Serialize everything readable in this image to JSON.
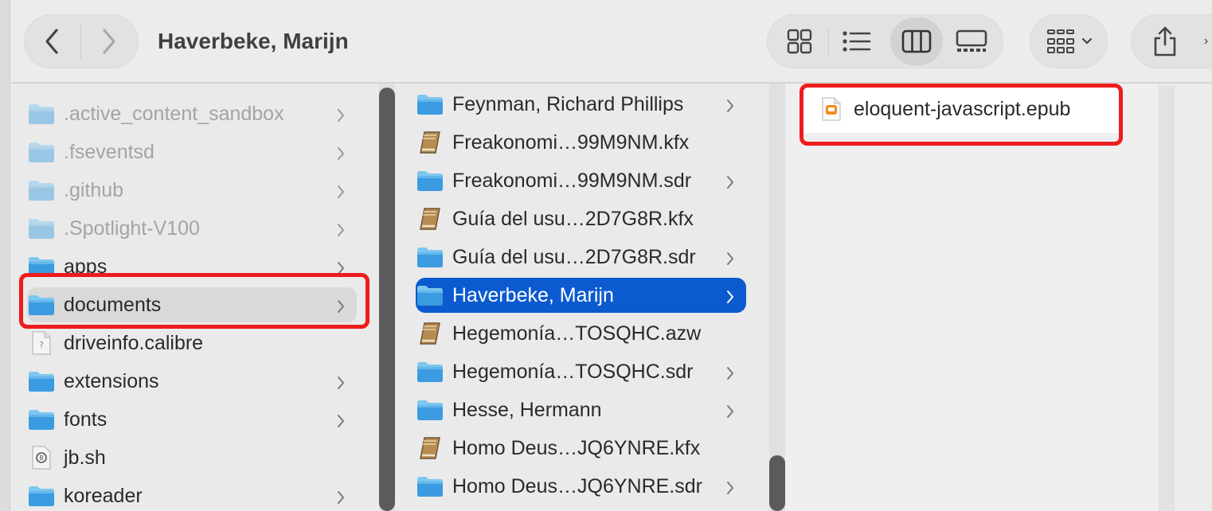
{
  "window": {
    "title": "Haverbeke, Marijn"
  },
  "toolbar": {
    "nav": {
      "back_icon": "chevron-left-icon",
      "forward_icon": "chevron-right-icon"
    },
    "view_modes": [
      {
        "name": "icon-view",
        "icon": "grid-icon"
      },
      {
        "name": "list-view",
        "icon": "list-icon"
      },
      {
        "name": "column-view",
        "icon": "columns-icon",
        "active": true
      },
      {
        "name": "gallery-view",
        "icon": "gallery-icon"
      }
    ],
    "group_icon": "group-by-icon",
    "share_icon": "share-icon"
  },
  "columns": [
    {
      "name": "root",
      "items": [
        {
          "label": ".active_content_sandbox",
          "kind": "folder",
          "hidden": true,
          "children": true
        },
        {
          "label": ".fseventsd",
          "kind": "folder",
          "hidden": true,
          "children": true
        },
        {
          "label": ".github",
          "kind": "folder",
          "hidden": true,
          "children": true
        },
        {
          "label": ".Spotlight-V100",
          "kind": "folder",
          "hidden": true,
          "children": true
        },
        {
          "label": "apps",
          "kind": "folder",
          "children": true
        },
        {
          "label": "documents",
          "kind": "folder",
          "children": true,
          "selected": true,
          "highlighted": true
        },
        {
          "label": "driveinfo.calibre",
          "kind": "unknown-file"
        },
        {
          "label": "extensions",
          "kind": "folder",
          "children": true
        },
        {
          "label": "fonts",
          "kind": "folder",
          "children": true
        },
        {
          "label": "jb.sh",
          "kind": "script-file"
        },
        {
          "label": "koreader",
          "kind": "folder",
          "children": true
        }
      ]
    },
    {
      "name": "documents",
      "items": [
        {
          "label": "Feynman, Richard Phillips",
          "kind": "folder",
          "children": true
        },
        {
          "label": "Freakonomi…99M9NM.kfx",
          "kind": "book-file"
        },
        {
          "label": "Freakonomi…99M9NM.sdr",
          "kind": "folder",
          "children": true
        },
        {
          "label": "Guía del usu…2D7G8R.kfx",
          "kind": "book-file"
        },
        {
          "label": "Guía del usu…2D7G8R.sdr",
          "kind": "folder",
          "children": true
        },
        {
          "label": "Haverbeke, Marijn",
          "kind": "folder",
          "children": true,
          "selected": true
        },
        {
          "label": "Hegemonía…TOSQHC.azw",
          "kind": "book-file"
        },
        {
          "label": "Hegemonía…TOSQHC.sdr",
          "kind": "folder",
          "children": true
        },
        {
          "label": "Hesse, Hermann",
          "kind": "folder",
          "children": true
        },
        {
          "label": "Homo Deus…JQ6YNRE.kfx",
          "kind": "book-file"
        },
        {
          "label": "Homo Deus…JQ6YNRE.sdr",
          "kind": "folder",
          "children": true
        }
      ]
    },
    {
      "name": "haverbeke",
      "items": [
        {
          "label": "eloquent-javascript.epub",
          "kind": "epub-file",
          "highlighted": true
        }
      ]
    }
  ],
  "colors": {
    "folder_top": "#7cc6ef",
    "folder_body": "#3a9be0",
    "selection_blue": "#0b5ad0",
    "highlight_red": "#ee1c1c"
  }
}
